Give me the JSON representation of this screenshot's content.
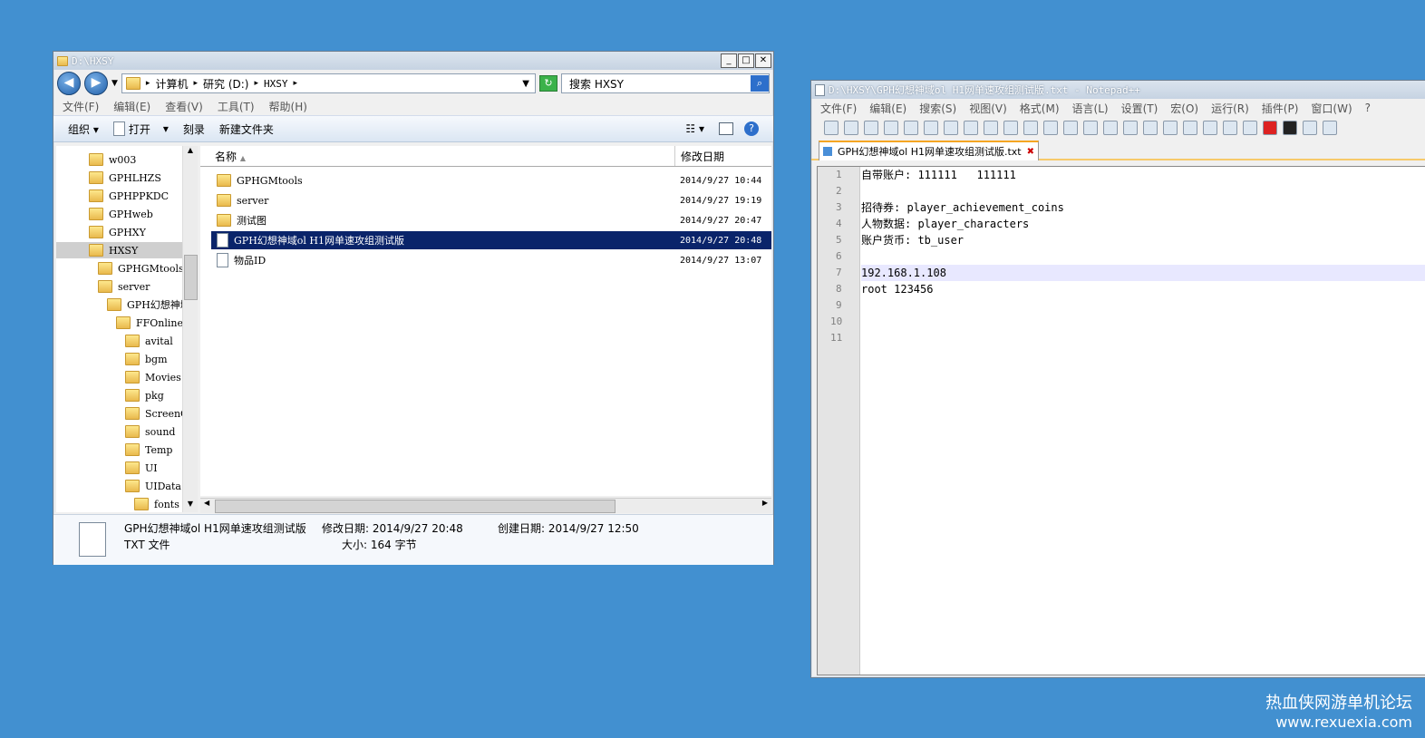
{
  "explorer": {
    "title": "D:\\HXSY",
    "back": "◀",
    "forward": "▶",
    "address": [
      "计算机",
      "研究 (D:)",
      "HXSY"
    ],
    "search_placeholder": "搜索 HXSY",
    "menu": [
      "文件(F)",
      "编辑(E)",
      "查看(V)",
      "工具(T)",
      "帮助(H)"
    ],
    "toolbar": {
      "organize": "组织",
      "open": "打开",
      "burn": "刻录",
      "new_folder": "新建文件夹"
    },
    "tree": [
      {
        "label": "w003",
        "indent": 0
      },
      {
        "label": "GPHLHZS",
        "indent": 0
      },
      {
        "label": "GPHPPKDC",
        "indent": 0
      },
      {
        "label": "GPHweb",
        "indent": 0
      },
      {
        "label": "GPHXY",
        "indent": 0
      },
      {
        "label": "HXSY",
        "indent": 0,
        "selected": true
      },
      {
        "label": "GPHGMtools",
        "indent": 1
      },
      {
        "label": "server",
        "indent": 1
      },
      {
        "label": "GPH幻想神域",
        "indent": 2
      },
      {
        "label": "FFOnline",
        "indent": 3
      },
      {
        "label": "avital",
        "indent": 4
      },
      {
        "label": "bgm",
        "indent": 4
      },
      {
        "label": "Movies",
        "indent": 4
      },
      {
        "label": "pkg",
        "indent": 4
      },
      {
        "label": "ScreenC",
        "indent": 4
      },
      {
        "label": "sound",
        "indent": 4
      },
      {
        "label": "Temp",
        "indent": 4
      },
      {
        "label": "UI",
        "indent": 4
      },
      {
        "label": "UIData",
        "indent": 4
      },
      {
        "label": "fonts",
        "indent": 5
      }
    ],
    "columns": {
      "name": "名称",
      "modified": "修改日期"
    },
    "files": [
      {
        "name": "GPHGMtools",
        "date": "2014/9/27 10:44",
        "type": "folder"
      },
      {
        "name": "server",
        "date": "2014/9/27 19:19",
        "type": "folder"
      },
      {
        "name": "测试图",
        "date": "2014/9/27 20:47",
        "type": "folder"
      },
      {
        "name": "GPH幻想神域ol H1网单速攻组测试版",
        "date": "2014/9/27 20:48",
        "type": "file",
        "selected": true
      },
      {
        "name": "物品ID",
        "date": "2014/9/27 13:07",
        "type": "file"
      }
    ],
    "details": {
      "name": "GPH幻想神域ol H1网单速攻组测试版",
      "type": "TXT 文件",
      "modified": "修改日期: 2014/9/27 20:48",
      "size": "大小: 164 字节",
      "created": "创建日期: 2014/9/27 12:50"
    }
  },
  "notepad": {
    "title": "D:\\HXSY\\GPH幻想神域ol H1网单速攻组测试版.txt - Notepad++",
    "menu": [
      "文件(F)",
      "编辑(E)",
      "搜索(S)",
      "视图(V)",
      "格式(M)",
      "语言(L)",
      "设置(T)",
      "宏(O)",
      "运行(R)",
      "插件(P)",
      "窗口(W)",
      "?"
    ],
    "tab": "GPH幻想神域ol H1网单速攻组测试版.txt",
    "lines": [
      "自带账户: 111111   111111",
      "",
      "招待券: player_achievement_coins",
      "人物数据: player_characters",
      "账户货币: tb_user",
      "",
      "192.168.1.108",
      "root 123456",
      "",
      "",
      ""
    ],
    "line_numbers": [
      "1",
      "2",
      "3",
      "4",
      "5",
      "6",
      "7",
      "8",
      "9",
      "10",
      "11"
    ],
    "current_line": 7
  },
  "watermark": {
    "line1": "热血侠网游单机论坛",
    "line2": "www.rexuexia.com"
  }
}
